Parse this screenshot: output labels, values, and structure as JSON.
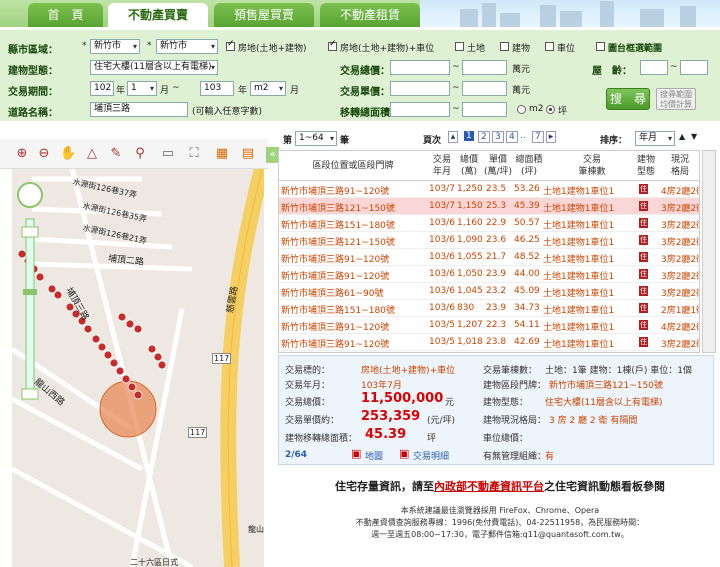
{
  "nav": {
    "tabs": [
      "首　頁",
      "不動產買賣",
      "預售屋買賣",
      "不動產租賃"
    ]
  },
  "search": {
    "county_label": "縣市區域：",
    "county": "新竹市",
    "district": "新竹市",
    "chk_land_building": "房地(土地+建物)",
    "chk_land_building_parking": "房地(土地+建物)+車位",
    "chk_land": "土地",
    "chk_building": "建物",
    "chk_parking": "車位",
    "chk_range_label": "圖台框選範圍",
    "building_type_label": "建物型態：",
    "building_type": "住宅大樓(11層含以上有電梯)",
    "total_price_label": "交易總價：",
    "unit_wan": "萬元",
    "age_label": "屋　齡：",
    "period_label": "交易期間：",
    "y1": "102",
    "m1": "1",
    "y2": "103",
    "m2": "m2",
    "unit_year": "年",
    "unit_month": "月",
    "unit_price_label": "交易單價：",
    "road_label": "道路名稱：",
    "road": "埔頂三路",
    "road_hint": "(可輸入任意字數)",
    "area_label": "移轉總面積：",
    "ping": "坪",
    "search_btn": "搜　尋",
    "alt_btn": "搜尋範圍\n均價計算",
    "tilde": "~"
  },
  "pager": {
    "range_select": "1~64",
    "prefix": "第",
    "suffix": "筆",
    "page_label": "頁次",
    "pages": [
      "1",
      "2",
      "3",
      "4",
      "..",
      "7"
    ],
    "sort_label": "排序：",
    "sort_value": "年月"
  },
  "grid": {
    "headers": {
      "loc": "區段位置或區段門牌",
      "ym": "交易\n年月",
      "total": "總價\n(萬)",
      "unit": "單價\n(萬/坪)",
      "area": "總面積\n(坪)",
      "trans": "交易\n筆棟數",
      "btype": "建物\n型態",
      "layout": "現況\n格局"
    },
    "rows": [
      {
        "loc": "新竹市埔頂三路91~120號",
        "ym": "103/7",
        "total": "1,250",
        "unit": "23.5",
        "area": "53.26",
        "trans": "土地1建物1車位1",
        "btype": "住",
        "layout": "4房2廳2衛"
      },
      {
        "loc": "新竹市埔頂三路121~150號",
        "ym": "103/7",
        "total": "1,150",
        "unit": "25.3",
        "area": "45.39",
        "trans": "土地1建物1車位1",
        "btype": "住",
        "layout": "3房2廳2衛"
      },
      {
        "loc": "新竹市埔頂三路151~180號",
        "ym": "103/6",
        "total": "1,160",
        "unit": "22.9",
        "area": "50.57",
        "trans": "土地1建物1車位1",
        "btype": "住",
        "layout": "3房2廳2衛"
      },
      {
        "loc": "新竹市埔頂三路121~150號",
        "ym": "103/6",
        "total": "1,090",
        "unit": "23.6",
        "area": "46.25",
        "trans": "土地1建物1車位1",
        "btype": "住",
        "layout": "3房2廳2衛"
      },
      {
        "loc": "新竹市埔頂三路91~120號",
        "ym": "103/6",
        "total": "1,055",
        "unit": "21.7",
        "area": "48.52",
        "trans": "土地1建物1車位1",
        "btype": "住",
        "layout": "3房2廳2衛"
      },
      {
        "loc": "新竹市埔頂三路91~120號",
        "ym": "103/6",
        "total": "1,050",
        "unit": "23.9",
        "area": "44.00",
        "trans": "土地1建物1車位1",
        "btype": "住",
        "layout": "3房2廳2衛"
      },
      {
        "loc": "新竹市埔頂三路61~90號",
        "ym": "103/6",
        "total": "1,045",
        "unit": "23.2",
        "area": "45.09",
        "trans": "土地1建物1車位1",
        "btype": "住",
        "layout": "3房2廳2衛"
      },
      {
        "loc": "新竹市埔頂三路151~180號",
        "ym": "103/6",
        "total": "830",
        "unit": "23.9",
        "area": "34.73",
        "trans": "土地1建物1車位1",
        "btype": "住",
        "layout": "2房1廳1衛"
      },
      {
        "loc": "新竹市埔頂三路91~120號",
        "ym": "103/5",
        "total": "1,207",
        "unit": "22.3",
        "area": "54.11",
        "trans": "土地1建物1車位1",
        "btype": "住",
        "layout": "4房2廳2衛"
      },
      {
        "loc": "新竹市埔頂三路91~120號",
        "ym": "103/5",
        "total": "1,018",
        "unit": "23.8",
        "area": "42.69",
        "trans": "土地1建物1車位1",
        "btype": "住",
        "layout": "3房2廳2衛"
      }
    ]
  },
  "detail": {
    "l_target": "交易標的：",
    "v_target": "房地(土地+建物)+車位",
    "l_ym": "交易年月：",
    "v_ym": "103年7月",
    "l_total": "交易總價：",
    "v_total": "11,500,000",
    "u_total": "元",
    "l_unit": "交易單價約：",
    "v_unit": "253,359",
    "u_unit": "(元/坪)",
    "l_area": "建物移轉總面積：",
    "v_area": "45.39",
    "u_area": "坪",
    "index": "2/64",
    "map_link": "地圖",
    "detail_link": "交易明細",
    "l_trans": "交易筆棟數：",
    "v_trans": "土地：1筆 建物：1棟(戶) 車位：1個",
    "l_addr": "建物區段門牌：",
    "v_addr": "新竹市埔頂三路121~150號",
    "l_btype": "建物型態：",
    "v_btype": "住宅大樓(11層含以上有電梯)",
    "l_layout": "建物現況格局：",
    "v_layout": "3 房 2 廳 2 衛 有隔間",
    "l_parking": "車位總價：",
    "l_mgmt": "有無管理組織：",
    "v_mgmt": "有"
  },
  "map": {
    "roads": [
      "埔頂二路",
      "埔頂三路",
      "龍山西路",
      "慈雲路",
      "水源街126巷37弄",
      "水源街126巷35弄",
      "水源街126巷21弄",
      "二十六區日式",
      "117",
      "117",
      "龍山"
    ],
    "marker_color": "#c62a2a"
  },
  "footer": {
    "line1_pre": "住宅存量資訊，請至",
    "line1_link": "內政部不動產資訊平台",
    "line1_post": "之住宅資訊動態看板參閱",
    "line2": "本系統建議最佳瀏覽器採用 FireFox、Chrome、Opera",
    "line3": "不動產資價查詢服務專線：1996(免付費電話)、04-22511958，為民服務時間：",
    "line4": "週一至週五08:00~17:30，電子郵件信箱:q11@quantasoft.com.tw。"
  }
}
